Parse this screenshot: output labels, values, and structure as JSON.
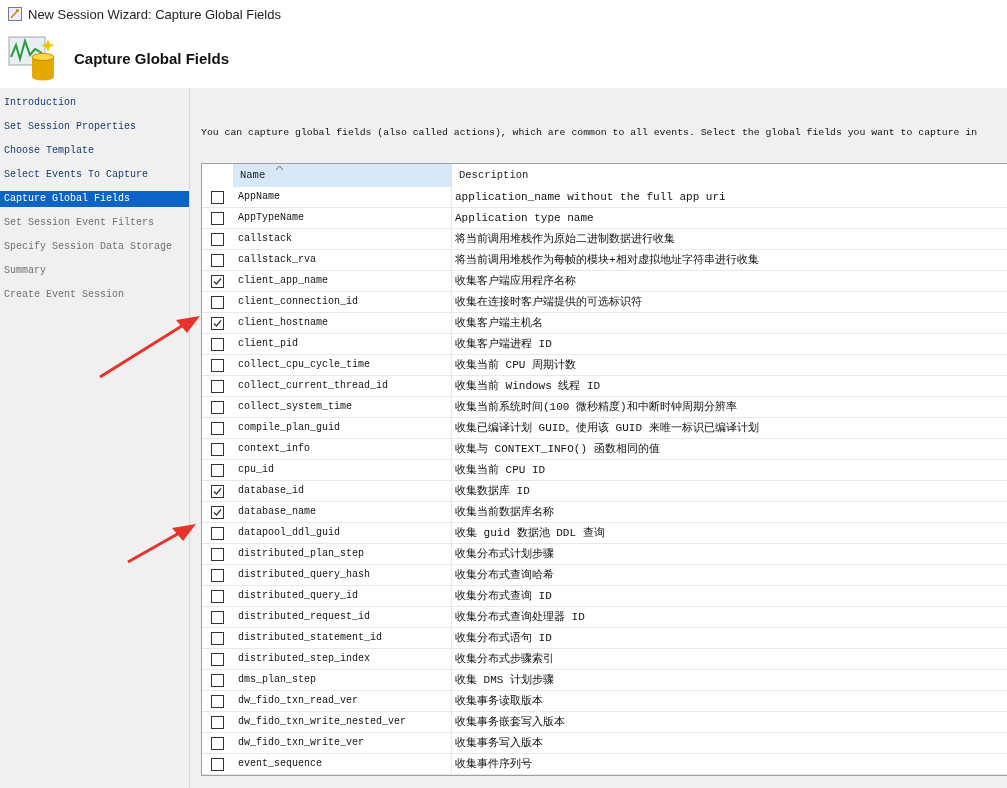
{
  "window": {
    "title": "New Session Wizard: Capture Global Fields"
  },
  "header": {
    "title": "Capture Global Fields"
  },
  "sidebar": {
    "items": [
      {
        "label": "Introduction",
        "selected": false,
        "disabled": false
      },
      {
        "label": "Set Session Properties",
        "selected": false,
        "disabled": false
      },
      {
        "label": "Choose Template",
        "selected": false,
        "disabled": false
      },
      {
        "label": "Select Events To Capture",
        "selected": false,
        "disabled": false
      },
      {
        "label": "Capture Global Fields",
        "selected": true,
        "disabled": false
      },
      {
        "label": "Set Session Event Filters",
        "selected": false,
        "disabled": true
      },
      {
        "label": "Specify Session Data Storage",
        "selected": false,
        "disabled": true
      },
      {
        "label": "Summary",
        "selected": false,
        "disabled": true
      },
      {
        "label": "Create Event Session",
        "selected": false,
        "disabled": true
      }
    ]
  },
  "intro": "You can capture global fields (also called actions), which are common to all events. Select the global fields you want to capture in",
  "table": {
    "columns": [
      {
        "label": "Name",
        "sorted": true
      },
      {
        "label": "Description",
        "sorted": false
      }
    ],
    "rows": [
      {
        "name": "AppName",
        "description": "application_name without the full app uri",
        "checked": false
      },
      {
        "name": "AppTypeName",
        "description": "Application type name",
        "checked": false
      },
      {
        "name": "callstack",
        "description": "将当前调用堆栈作为原始二进制数据进行收集",
        "checked": false
      },
      {
        "name": "callstack_rva",
        "description": "将当前调用堆栈作为每帧的模块+相对虚拟地址字符串进行收集",
        "checked": false
      },
      {
        "name": "client_app_name",
        "description": "收集客户端应用程序名称",
        "checked": true
      },
      {
        "name": "client_connection_id",
        "description": "收集在连接时客户端提供的可选标识符",
        "checked": false
      },
      {
        "name": "client_hostname",
        "description": "收集客户端主机名",
        "checked": true
      },
      {
        "name": "client_pid",
        "description": "收集客户端进程 ID",
        "checked": false
      },
      {
        "name": "collect_cpu_cycle_time",
        "description": "收集当前 CPU 周期计数",
        "checked": false
      },
      {
        "name": "collect_current_thread_id",
        "description": "收集当前 Windows 线程 ID",
        "checked": false
      },
      {
        "name": "collect_system_time",
        "description": "收集当前系统时间(100 微秒精度)和中断时钟周期分辨率",
        "checked": false
      },
      {
        "name": "compile_plan_guid",
        "description": "收集已编译计划 GUID。使用该 GUID 来唯一标识已编译计划",
        "checked": false
      },
      {
        "name": "context_info",
        "description": "收集与 CONTEXT_INFO() 函数相同的值",
        "checked": false
      },
      {
        "name": "cpu_id",
        "description": "收集当前 CPU ID",
        "checked": false
      },
      {
        "name": "database_id",
        "description": "收集数据库 ID",
        "checked": true
      },
      {
        "name": "database_name",
        "description": "收集当前数据库名称",
        "checked": true
      },
      {
        "name": "datapool_ddl_guid",
        "description": "收集 guid 数据池 DDL 查询",
        "checked": false
      },
      {
        "name": "distributed_plan_step",
        "description": "收集分布式计划步骤",
        "checked": false
      },
      {
        "name": "distributed_query_hash",
        "description": "收集分布式查询哈希",
        "checked": false
      },
      {
        "name": "distributed_query_id",
        "description": "收集分布式查询 ID",
        "checked": false
      },
      {
        "name": "distributed_request_id",
        "description": "收集分布式查询处理器 ID",
        "checked": false
      },
      {
        "name": "distributed_statement_id",
        "description": "收集分布式语句 ID",
        "checked": false
      },
      {
        "name": "distributed_step_index",
        "description": "收集分布式步骤索引",
        "checked": false
      },
      {
        "name": "dms_plan_step",
        "description": "收集 DMS 计划步骤",
        "checked": false
      },
      {
        "name": "dw_fido_txn_read_ver",
        "description": "收集事务读取版本",
        "checked": false
      },
      {
        "name": "dw_fido_txn_write_nested_ver",
        "description": "收集事务嵌套写入版本",
        "checked": false
      },
      {
        "name": "dw_fido_txn_write_ver",
        "description": "收集事务写入版本",
        "checked": false
      },
      {
        "name": "event_sequence",
        "description": "收集事件序列号",
        "checked": false
      }
    ]
  }
}
